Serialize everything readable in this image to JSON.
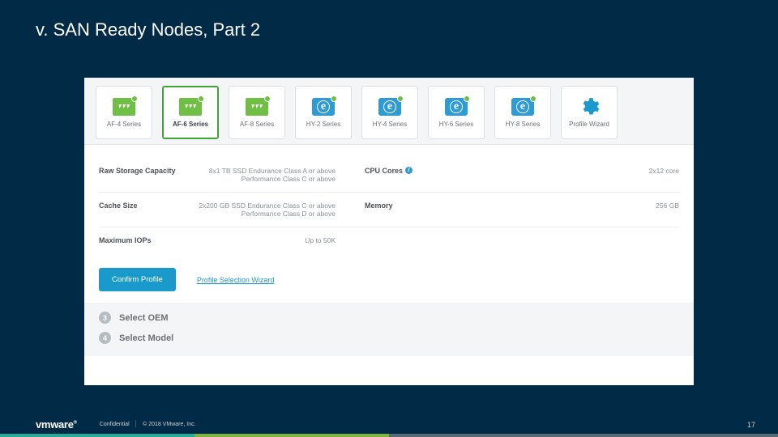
{
  "slide": {
    "title": "v. SAN Ready Nodes, Part 2"
  },
  "tabs": [
    {
      "label": "AF-4 Series",
      "style": "green"
    },
    {
      "label": "AF-6 Series",
      "style": "green",
      "active": true
    },
    {
      "label": "AF-8 Series",
      "style": "green"
    },
    {
      "label": "HY-2 Series",
      "style": "blue"
    },
    {
      "label": "HY-4 Series",
      "style": "blue"
    },
    {
      "label": "HY-6 Series",
      "style": "blue"
    },
    {
      "label": "HY-8 Series",
      "style": "blue"
    },
    {
      "label": "Profile Wizard",
      "style": "gear"
    }
  ],
  "specs": {
    "row1": {
      "label1": "Raw Storage Capacity",
      "val1": "8x1 TB SSD Endurance Class A or above\nPerformance Class C or above",
      "label2": "CPU Cores",
      "val2": "2x12 core"
    },
    "row2": {
      "label1": "Cache Size",
      "val1": "2x200 GB SSD Endurance Class C or above\nPerformance Class D or above",
      "label2": "Memory",
      "val2": "256 GB"
    },
    "row3": {
      "label1": "Maximum IOPs",
      "val1": "Up to 50K"
    }
  },
  "actions": {
    "confirm": "Confirm Profile",
    "wizard_link": "Profile Selection Wizard"
  },
  "steps": [
    {
      "num": "3",
      "label": "Select OEM"
    },
    {
      "num": "4",
      "label": "Select Model"
    }
  ],
  "footer": {
    "logo": "vmware",
    "confidential": "Confidential",
    "copyright": "© 2018 VMware, Inc.",
    "page": "17"
  }
}
